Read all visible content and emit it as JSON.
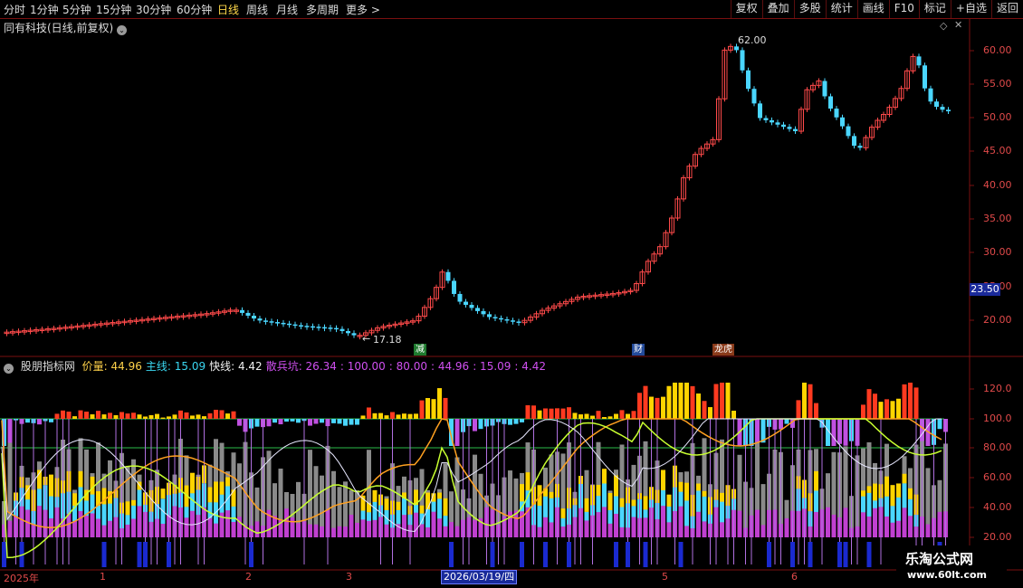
{
  "toolbar": {
    "periods": [
      "分时",
      "1分钟",
      "5分钟",
      "15分钟",
      "30分钟",
      "60分钟",
      "日线",
      "周线",
      "月线",
      "多周期",
      "更多 >"
    ],
    "active_period": "日线",
    "actions": [
      "复权",
      "叠加",
      "多股",
      "统计",
      "画线",
      "F10",
      "标记",
      "+自选",
      "返回"
    ]
  },
  "stock": {
    "title": "同有科技(日线,前复权)",
    "high_label": "62.00",
    "low_label": "17.18",
    "current_price": "23.50"
  },
  "price_axis": [
    "60.00",
    "55.00",
    "50.00",
    "45.00",
    "40.00",
    "35.00",
    "30.00",
    "25.00",
    "20.00"
  ],
  "events": [
    {
      "label": "减",
      "color": "#1e7a2e"
    },
    {
      "label": "财",
      "color": "#234a9a"
    },
    {
      "label": "龙虎",
      "color": "#8a3a1a"
    }
  ],
  "indicator": {
    "name": "股朋指标网",
    "items": [
      {
        "label": "价量:",
        "value": "44.96",
        "color": "#ffd24a"
      },
      {
        "label": "主线:",
        "value": "15.09",
        "color": "#3ad6f0"
      },
      {
        "label": "快线:",
        "value": "4.42",
        "color": "#f0f0f0"
      },
      {
        "label": "散兵坑:",
        "value": "26.34",
        "color": "#d050f0"
      },
      {
        "label": ":",
        "value": "100.00",
        "color": "#d050f0"
      },
      {
        "label": ":",
        "value": "80.00",
        "color": "#d050f0"
      },
      {
        "label": ":",
        "value": "44.96",
        "color": "#d050f0"
      },
      {
        "label": ":",
        "value": "15.09",
        "color": "#d050f0"
      },
      {
        "label": ":",
        "value": "4.42",
        "color": "#d050f0"
      }
    ],
    "axis": [
      "120.0",
      "100.0",
      "80.00",
      "60.00",
      "40.00",
      "20.00"
    ]
  },
  "timeline": {
    "labels": [
      "2025年",
      "1",
      "2",
      "3",
      "5",
      "6"
    ],
    "cursor_date": "2026/03/19/四"
  },
  "watermark": {
    "line1": "乐淘公式网",
    "line2": "www.60lt.com"
  },
  "colors": {
    "up": "#ff4a4a",
    "down": "#4ad6ff",
    "grid": "#7a1010",
    "accent": "#ffd84a"
  }
}
